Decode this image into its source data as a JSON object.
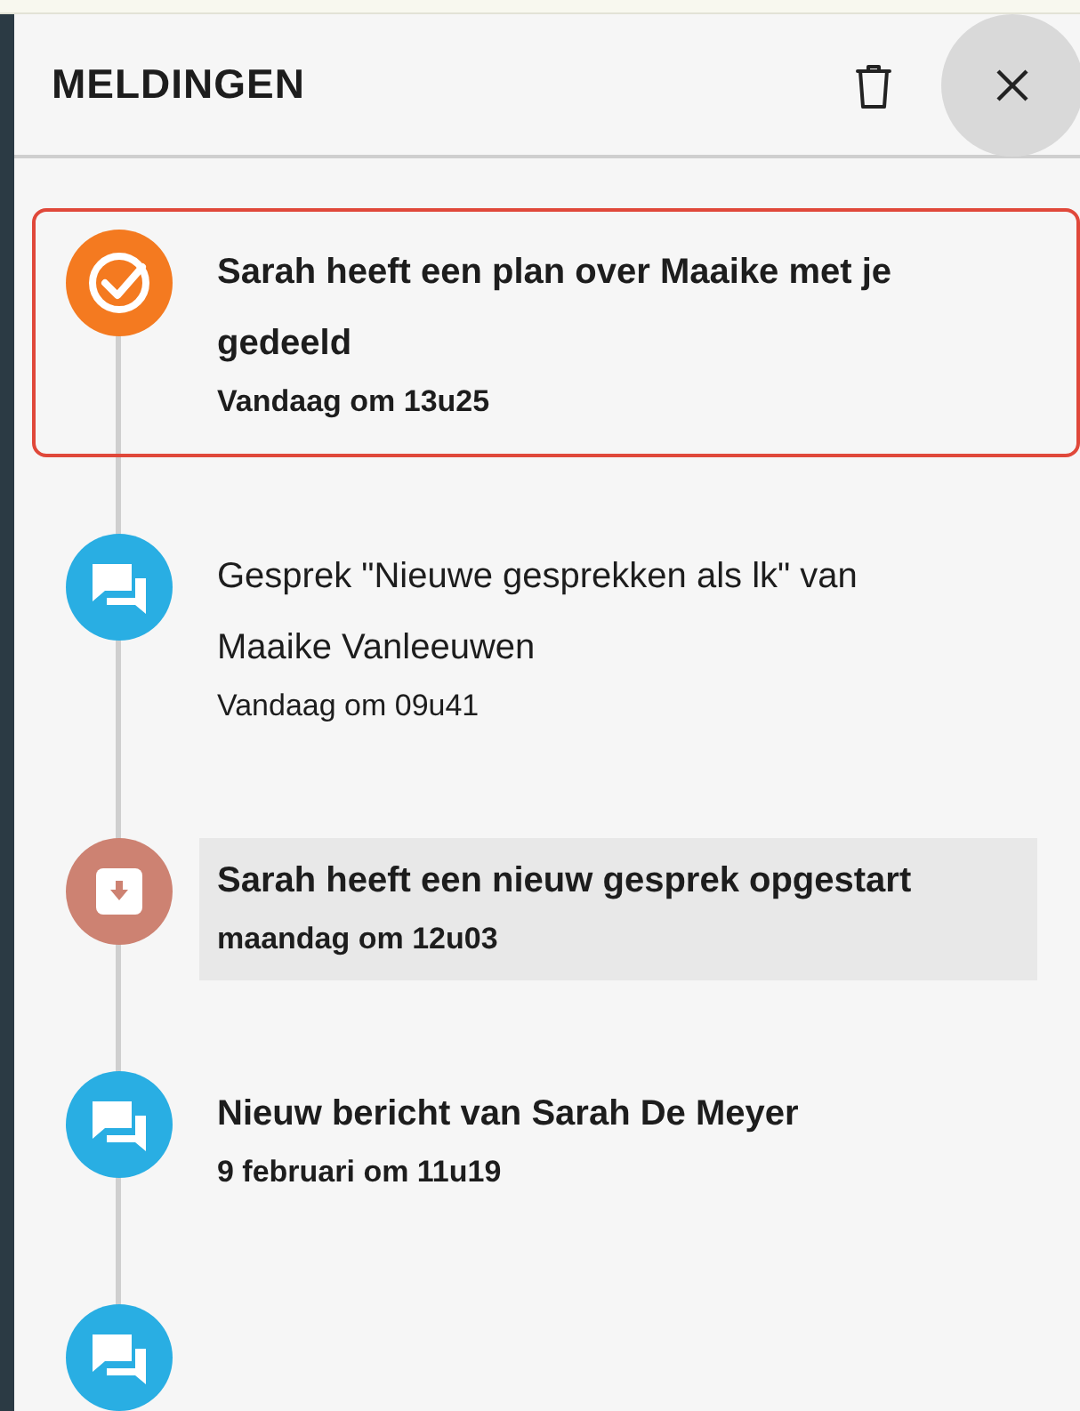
{
  "panel": {
    "title": "MELDINGEN"
  },
  "notifications": [
    {
      "kind": "plan",
      "title": "Sarah heeft een plan over Maaike met je gedeeld",
      "time": "Vandaag om 13u25",
      "unread": true,
      "selected": true,
      "highlighted": false
    },
    {
      "kind": "chat",
      "title": "Gesprek \"Nieuwe gesprekken als lk\" van Maaike Vanleeuwen",
      "time": "Vandaag om 09u41",
      "unread": false,
      "selected": false,
      "highlighted": false
    },
    {
      "kind": "archive",
      "title": "Sarah heeft een nieuw gesprek opgestart",
      "time": "maandag om 12u03",
      "unread": true,
      "selected": false,
      "highlighted": true
    },
    {
      "kind": "chat",
      "title": "Nieuw bericht van Sarah De Meyer",
      "time": "9 februari om 11u19",
      "unread": true,
      "selected": false,
      "highlighted": false
    },
    {
      "kind": "chat"
    }
  ]
}
